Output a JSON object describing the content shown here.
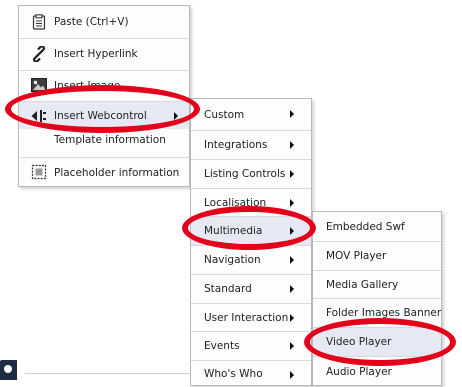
{
  "menu1": {
    "items": [
      {
        "label": "Paste (Ctrl+V)",
        "icon": "clipboard-icon"
      },
      {
        "label": "Insert Hyperlink",
        "icon": "link-icon"
      },
      {
        "label": "Insert Image",
        "icon": "image-icon"
      },
      {
        "label": "Insert Webcontrol",
        "icon": "webcontrol-icon"
      },
      {
        "label": "Template information",
        "icon": ""
      },
      {
        "label": "Placeholder information",
        "icon": "placeholder-icon"
      }
    ]
  },
  "menu2": {
    "items": [
      {
        "label": "Custom"
      },
      {
        "label": "Integrations"
      },
      {
        "label": "Listing Controls"
      },
      {
        "label": "Localisation"
      },
      {
        "label": "Multimedia"
      },
      {
        "label": "Navigation"
      },
      {
        "label": "Standard"
      },
      {
        "label": "User Interaction"
      },
      {
        "label": "Events"
      },
      {
        "label": "Who's Who"
      }
    ]
  },
  "menu3": {
    "items": [
      {
        "label": "Embedded Swf"
      },
      {
        "label": "MOV Player"
      },
      {
        "label": "Media Gallery"
      },
      {
        "label": "Folder Images Banner"
      },
      {
        "label": "Video Player"
      },
      {
        "label": "Audio Player"
      }
    ]
  },
  "highlight_color": "#e3001b"
}
